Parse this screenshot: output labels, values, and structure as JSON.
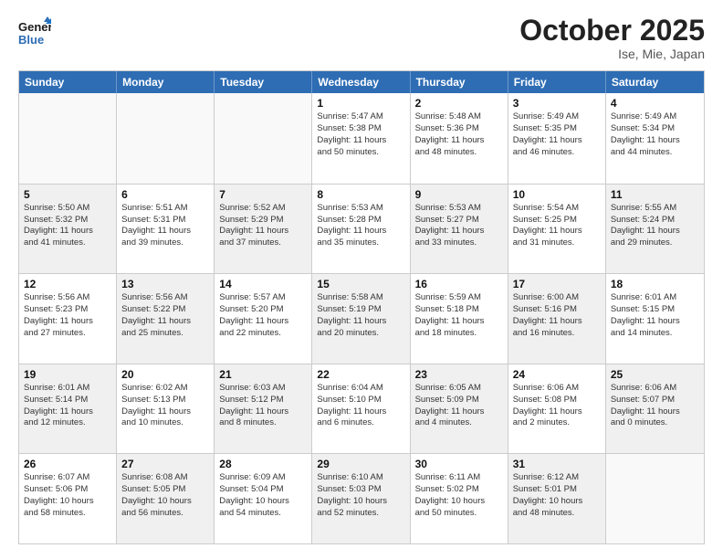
{
  "header": {
    "logo_general": "General",
    "logo_blue": "Blue",
    "month": "October 2025",
    "location": "Ise, Mie, Japan"
  },
  "weekdays": [
    "Sunday",
    "Monday",
    "Tuesday",
    "Wednesday",
    "Thursday",
    "Friday",
    "Saturday"
  ],
  "rows": [
    [
      {
        "day": "",
        "info": "",
        "empty": true
      },
      {
        "day": "",
        "info": "",
        "empty": true
      },
      {
        "day": "",
        "info": "",
        "empty": true
      },
      {
        "day": "1",
        "info": "Sunrise: 5:47 AM\nSunset: 5:38 PM\nDaylight: 11 hours\nand 50 minutes."
      },
      {
        "day": "2",
        "info": "Sunrise: 5:48 AM\nSunset: 5:36 PM\nDaylight: 11 hours\nand 48 minutes."
      },
      {
        "day": "3",
        "info": "Sunrise: 5:49 AM\nSunset: 5:35 PM\nDaylight: 11 hours\nand 46 minutes."
      },
      {
        "day": "4",
        "info": "Sunrise: 5:49 AM\nSunset: 5:34 PM\nDaylight: 11 hours\nand 44 minutes."
      }
    ],
    [
      {
        "day": "5",
        "info": "Sunrise: 5:50 AM\nSunset: 5:32 PM\nDaylight: 11 hours\nand 41 minutes.",
        "shaded": true
      },
      {
        "day": "6",
        "info": "Sunrise: 5:51 AM\nSunset: 5:31 PM\nDaylight: 11 hours\nand 39 minutes."
      },
      {
        "day": "7",
        "info": "Sunrise: 5:52 AM\nSunset: 5:29 PM\nDaylight: 11 hours\nand 37 minutes.",
        "shaded": true
      },
      {
        "day": "8",
        "info": "Sunrise: 5:53 AM\nSunset: 5:28 PM\nDaylight: 11 hours\nand 35 minutes."
      },
      {
        "day": "9",
        "info": "Sunrise: 5:53 AM\nSunset: 5:27 PM\nDaylight: 11 hours\nand 33 minutes.",
        "shaded": true
      },
      {
        "day": "10",
        "info": "Sunrise: 5:54 AM\nSunset: 5:25 PM\nDaylight: 11 hours\nand 31 minutes."
      },
      {
        "day": "11",
        "info": "Sunrise: 5:55 AM\nSunset: 5:24 PM\nDaylight: 11 hours\nand 29 minutes.",
        "shaded": true
      }
    ],
    [
      {
        "day": "12",
        "info": "Sunrise: 5:56 AM\nSunset: 5:23 PM\nDaylight: 11 hours\nand 27 minutes."
      },
      {
        "day": "13",
        "info": "Sunrise: 5:56 AM\nSunset: 5:22 PM\nDaylight: 11 hours\nand 25 minutes.",
        "shaded": true
      },
      {
        "day": "14",
        "info": "Sunrise: 5:57 AM\nSunset: 5:20 PM\nDaylight: 11 hours\nand 22 minutes."
      },
      {
        "day": "15",
        "info": "Sunrise: 5:58 AM\nSunset: 5:19 PM\nDaylight: 11 hours\nand 20 minutes.",
        "shaded": true
      },
      {
        "day": "16",
        "info": "Sunrise: 5:59 AM\nSunset: 5:18 PM\nDaylight: 11 hours\nand 18 minutes."
      },
      {
        "day": "17",
        "info": "Sunrise: 6:00 AM\nSunset: 5:16 PM\nDaylight: 11 hours\nand 16 minutes.",
        "shaded": true
      },
      {
        "day": "18",
        "info": "Sunrise: 6:01 AM\nSunset: 5:15 PM\nDaylight: 11 hours\nand 14 minutes."
      }
    ],
    [
      {
        "day": "19",
        "info": "Sunrise: 6:01 AM\nSunset: 5:14 PM\nDaylight: 11 hours\nand 12 minutes.",
        "shaded": true
      },
      {
        "day": "20",
        "info": "Sunrise: 6:02 AM\nSunset: 5:13 PM\nDaylight: 11 hours\nand 10 minutes."
      },
      {
        "day": "21",
        "info": "Sunrise: 6:03 AM\nSunset: 5:12 PM\nDaylight: 11 hours\nand 8 minutes.",
        "shaded": true
      },
      {
        "day": "22",
        "info": "Sunrise: 6:04 AM\nSunset: 5:10 PM\nDaylight: 11 hours\nand 6 minutes."
      },
      {
        "day": "23",
        "info": "Sunrise: 6:05 AM\nSunset: 5:09 PM\nDaylight: 11 hours\nand 4 minutes.",
        "shaded": true
      },
      {
        "day": "24",
        "info": "Sunrise: 6:06 AM\nSunset: 5:08 PM\nDaylight: 11 hours\nand 2 minutes."
      },
      {
        "day": "25",
        "info": "Sunrise: 6:06 AM\nSunset: 5:07 PM\nDaylight: 11 hours\nand 0 minutes.",
        "shaded": true
      }
    ],
    [
      {
        "day": "26",
        "info": "Sunrise: 6:07 AM\nSunset: 5:06 PM\nDaylight: 10 hours\nand 58 minutes."
      },
      {
        "day": "27",
        "info": "Sunrise: 6:08 AM\nSunset: 5:05 PM\nDaylight: 10 hours\nand 56 minutes.",
        "shaded": true
      },
      {
        "day": "28",
        "info": "Sunrise: 6:09 AM\nSunset: 5:04 PM\nDaylight: 10 hours\nand 54 minutes."
      },
      {
        "day": "29",
        "info": "Sunrise: 6:10 AM\nSunset: 5:03 PM\nDaylight: 10 hours\nand 52 minutes.",
        "shaded": true
      },
      {
        "day": "30",
        "info": "Sunrise: 6:11 AM\nSunset: 5:02 PM\nDaylight: 10 hours\nand 50 minutes."
      },
      {
        "day": "31",
        "info": "Sunrise: 6:12 AM\nSunset: 5:01 PM\nDaylight: 10 hours\nand 48 minutes.",
        "shaded": true
      },
      {
        "day": "",
        "info": "",
        "empty": true
      }
    ]
  ]
}
